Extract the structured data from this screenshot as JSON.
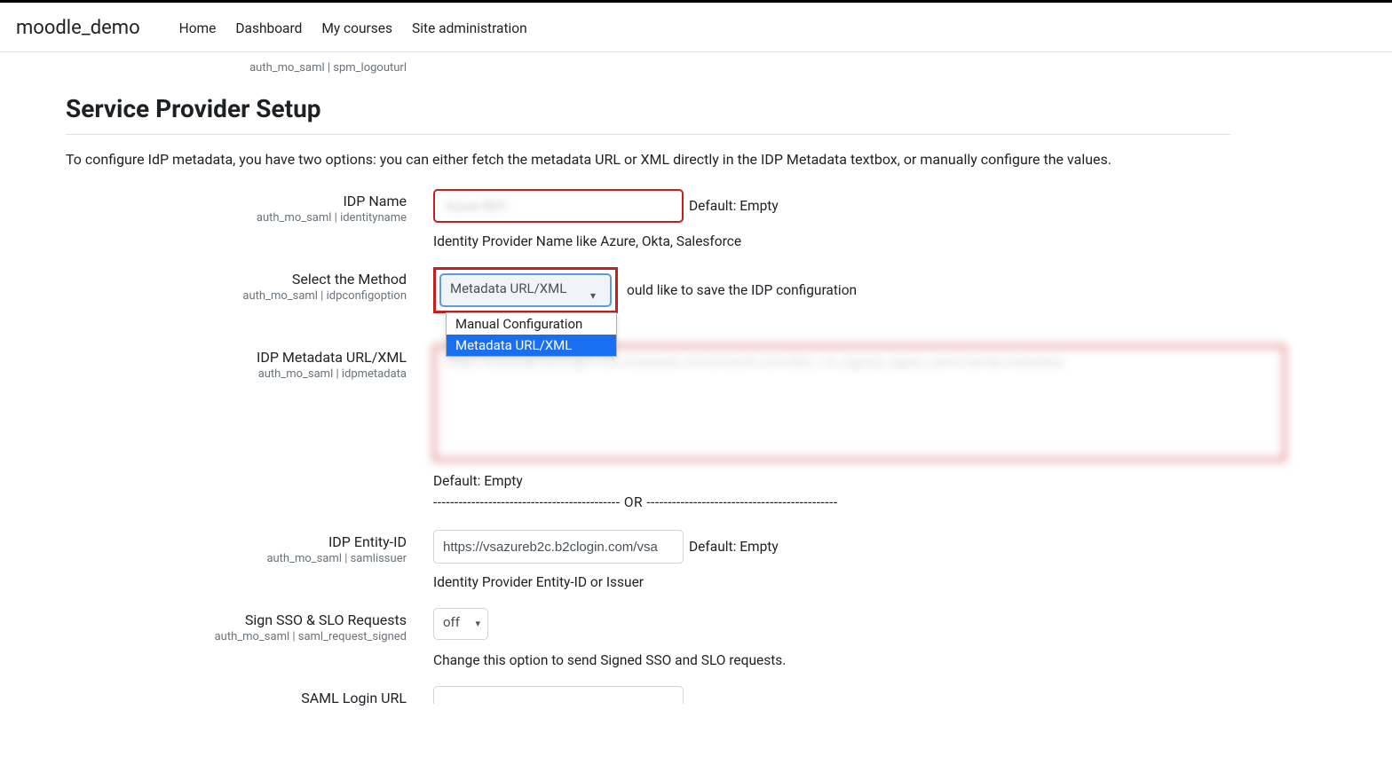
{
  "brand": "moodle_demo",
  "nav": {
    "home": "Home",
    "dashboard": "Dashboard",
    "mycourses": "My courses",
    "siteadmin": "Site administration"
  },
  "prev_row_sub": "auth_mo_saml | spm_logouturl",
  "heading": "Service Provider Setup",
  "intro": "To configure IdP metadata, you have two options: you can either fetch the metadata URL or XML directly in the IDP Metadata textbox, or manually configure the values.",
  "fields": {
    "idpname": {
      "label": "IDP Name",
      "sub": "auth_mo_saml | identityname",
      "value_preview": "Azure B2C",
      "default": "Default: Empty",
      "hint": "Identity Provider Name like Azure, Okta, Salesforce"
    },
    "method": {
      "label": "Select the Method",
      "sub": "auth_mo_saml | idpconfigoption",
      "selected": "Metadata URL/XML",
      "option_manual": "Manual Configuration",
      "option_metadata": "Metadata URL/XML",
      "hint_partial": "ould like to save the IDP configuration"
    },
    "idpmeta": {
      "label": "IDP Metadata URL/XML",
      "sub": "auth_mo_saml | idpmetadata",
      "value_preview": "https://example.b2clogin.com/example.onmicrosoft.com/B2C_1A_signup_signin_saml/samlp/metadata",
      "default": "Default: Empty"
    },
    "or_line": "-------------------------------------------- OR ---------------------------------------------",
    "entityid": {
      "label": "IDP Entity-ID",
      "sub": "auth_mo_saml | samlissuer",
      "value": "https://vsazureb2c.b2clogin.com/vsa",
      "default": "Default: Empty",
      "hint": "Identity Provider Entity-ID or Issuer"
    },
    "sign": {
      "label": "Sign SSO & SLO Requests",
      "sub": "auth_mo_saml | saml_request_signed",
      "value": "off",
      "hint": "Change this option to send Signed SSO and SLO requests."
    },
    "loginurl": {
      "label": "SAML Login URL"
    }
  }
}
